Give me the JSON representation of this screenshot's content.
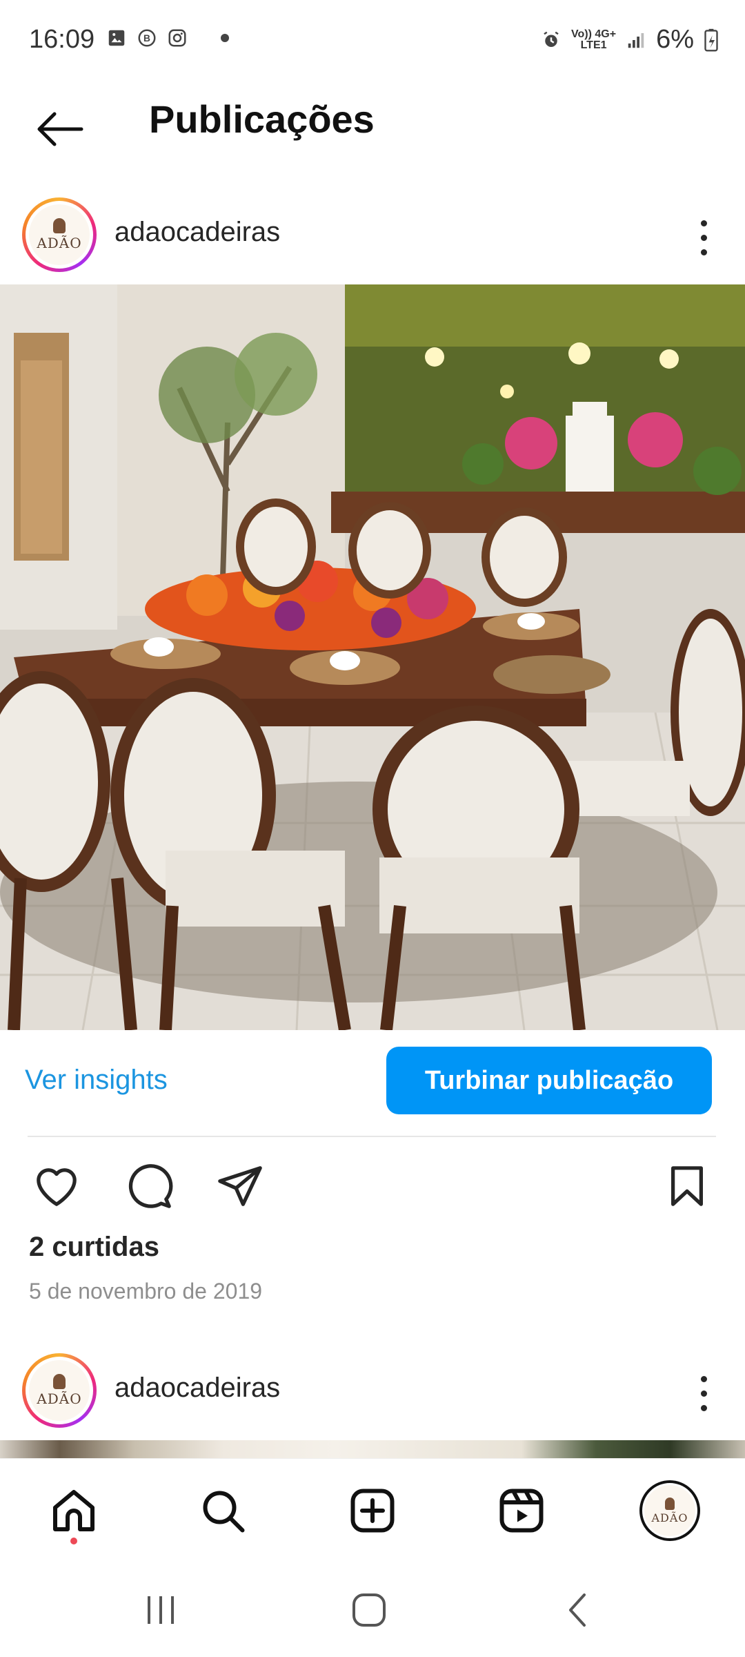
{
  "status_bar": {
    "time": "16:09",
    "net_top": "Vo)) 4G+",
    "net_bottom": "LTE1",
    "battery": "6%"
  },
  "header": {
    "title": "Publicações"
  },
  "post": {
    "username": "adaocadeiras",
    "avatar_logo_text": "ADÃO",
    "ver_insights": "Ver insights",
    "boost_label": "Turbinar publicação",
    "likes": "2 curtidas",
    "date": "5 de novembro de 2019",
    "icons": [
      "heart-icon",
      "comment-icon",
      "share-icon",
      "bookmark-icon"
    ]
  },
  "post2": {
    "username": "adaocadeiras",
    "avatar_logo_text": "ADÃO"
  },
  "bottom_nav": {
    "items": [
      "home-icon",
      "search-icon",
      "create-icon",
      "reels-icon",
      "profile-avatar"
    ],
    "profile_logo_text": "ADÃO"
  },
  "colors": {
    "accent": "#0095f6",
    "link": "#1b95e0",
    "notification_dot": "#ed4956"
  }
}
